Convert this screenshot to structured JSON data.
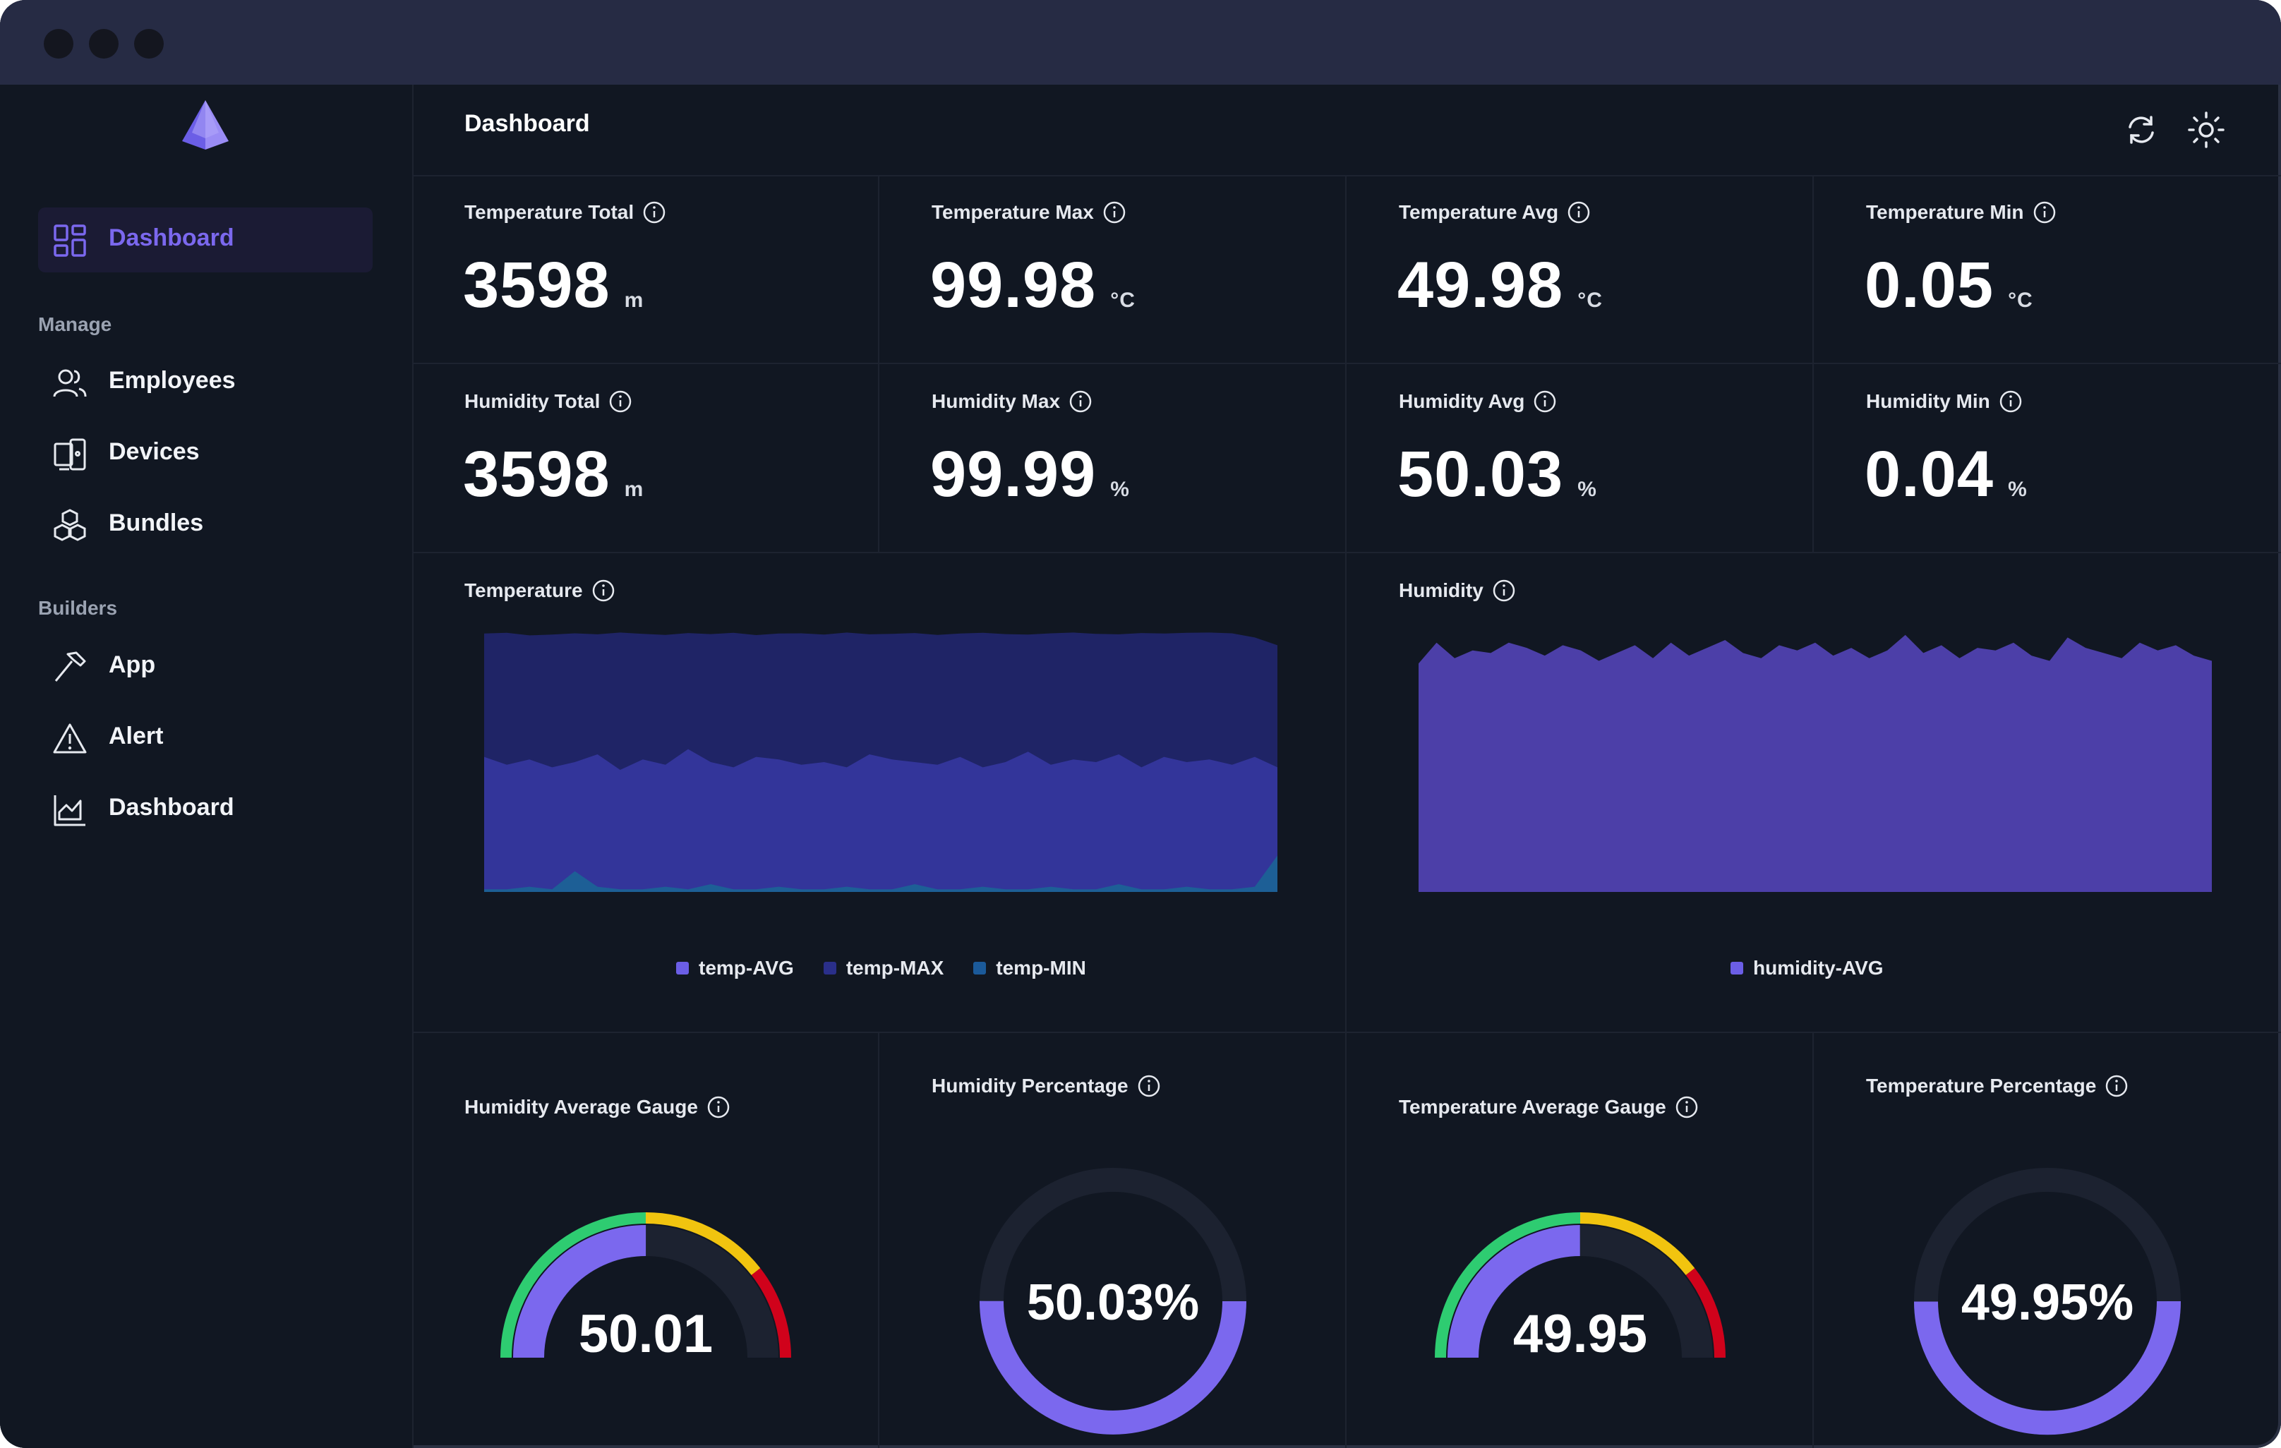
{
  "sidebar": {
    "items": [
      {
        "label": "Dashboard",
        "icon": "layout-grid-icon",
        "active": true
      },
      {
        "label": "Employees",
        "icon": "users-icon"
      },
      {
        "label": "Devices",
        "icon": "devices-icon"
      },
      {
        "label": "Bundles",
        "icon": "bundles-icon"
      },
      {
        "label": "App",
        "icon": "hammer-icon"
      },
      {
        "label": "Alert",
        "icon": "alert-triangle-icon"
      },
      {
        "label": "Dashboard",
        "icon": "chart-line-icon"
      }
    ],
    "sections": {
      "manage": "Manage",
      "builders": "Builders"
    }
  },
  "header": {
    "title": "Dashboard",
    "refresh_icon": "refresh-icon",
    "theme_icon": "sun-icon"
  },
  "stats": [
    {
      "title": "Temperature Total",
      "value": "3598",
      "unit": "m"
    },
    {
      "title": "Temperature Max",
      "value": "99.98",
      "unit": "°C"
    },
    {
      "title": "Temperature Avg",
      "value": "49.98",
      "unit": "°C"
    },
    {
      "title": "Temperature Min",
      "value": "0.05",
      "unit": "°C"
    },
    {
      "title": "Humidity Total",
      "value": "3598",
      "unit": "m"
    },
    {
      "title": "Humidity Max",
      "value": "99.99",
      "unit": "%"
    },
    {
      "title": "Humidity Avg",
      "value": "50.03",
      "unit": "%"
    },
    {
      "title": "Humidity Min",
      "value": "0.04",
      "unit": "%"
    }
  ],
  "charts": {
    "temperature": {
      "title": "Temperature",
      "legend": [
        "temp-AVG",
        "temp-MAX",
        "temp-MIN"
      ],
      "colors": [
        "#6b5ee6",
        "#2a2f8a",
        "#1b5a9a"
      ]
    },
    "humidity": {
      "title": "Humidity",
      "legend": [
        "humidity-AVG"
      ],
      "colors": [
        "#6b5ee6"
      ]
    }
  },
  "chart_data": [
    {
      "type": "area",
      "series": [
        {
          "name": "temp-MAX",
          "values": [
            99.5,
            99.8,
            98.8,
            99.1,
            99.6,
            99.2,
            99.9,
            99.4,
            99.0,
            99.7,
            99.3,
            99.8,
            98.9,
            99.5,
            99.6,
            99.1,
            99.9,
            99.2,
            99.4,
            99.7,
            99.0,
            99.5,
            99.8,
            99.3,
            99.1,
            99.6,
            99.9,
            99.4,
            99.2,
            99.7,
            99.5,
            99.8,
            99.9,
            99.6,
            98.0,
            95.0
          ]
        },
        {
          "name": "temp-AVG",
          "values": [
            52,
            49,
            51,
            48,
            50,
            53,
            47,
            51,
            49,
            55,
            50,
            48,
            52,
            51,
            49,
            50,
            48,
            53,
            51,
            50,
            49,
            52,
            48,
            50,
            54,
            49,
            51,
            50,
            53,
            48,
            52,
            50,
            51,
            49,
            52,
            48
          ]
        },
        {
          "name": "temp-MIN",
          "values": [
            1,
            1,
            2,
            1,
            8,
            2,
            1,
            1,
            2,
            1,
            3,
            1,
            1,
            2,
            1,
            1,
            2,
            1,
            1,
            3,
            1,
            1,
            2,
            1,
            1,
            2,
            1,
            1,
            3,
            1,
            1,
            2,
            1,
            1,
            2,
            14
          ]
        }
      ]
    },
    {
      "type": "area",
      "series": [
        {
          "name": "humidity-AVG",
          "values": [
            88,
            96,
            90,
            93,
            92,
            96,
            94,
            91,
            95,
            93,
            89,
            92,
            95,
            90,
            96,
            91,
            94,
            97,
            92,
            90,
            95,
            93,
            96,
            91,
            94,
            90,
            93,
            99,
            92,
            95,
            90,
            94,
            93,
            96,
            91,
            89,
            98,
            94,
            92,
            90,
            96,
            93,
            95,
            91,
            89
          ]
        }
      ]
    }
  ],
  "gauges": [
    {
      "title": "Humidity Average Gauge",
      "value": "50.01",
      "value_num": 50.01,
      "kind": "semi"
    },
    {
      "title": "Humidity Percentage",
      "value": "50.03%",
      "value_num": 50.03,
      "kind": "ring"
    },
    {
      "title": "Temperature Average Gauge",
      "value": "49.95",
      "value_num": 49.95,
      "kind": "semi"
    },
    {
      "title": "Temperature Percentage",
      "value": "49.95%",
      "value_num": 49.95,
      "kind": "ring"
    }
  ],
  "colors": {
    "accent": "#7b68ee",
    "green": "#2ecc71",
    "yellow": "#f1c40f",
    "red": "#d0021b"
  }
}
